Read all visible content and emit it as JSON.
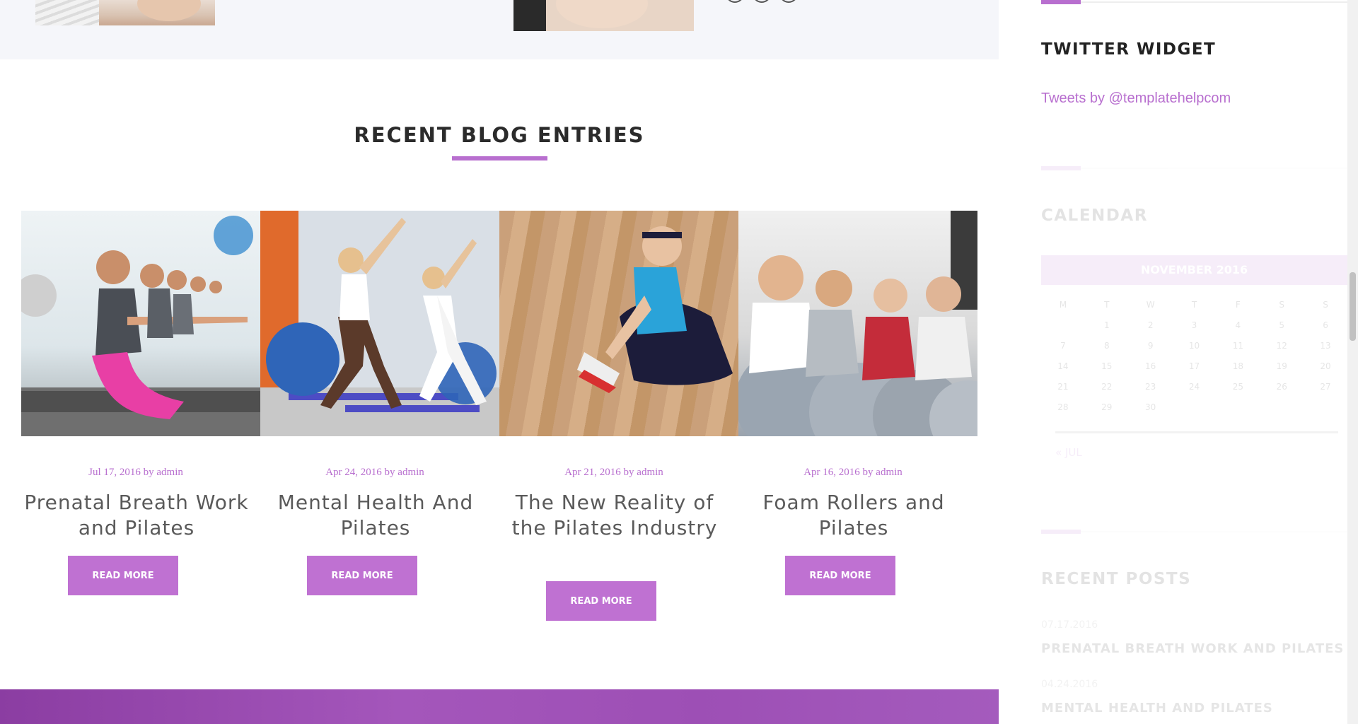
{
  "section": {
    "title": "RECENT BLOG ENTRIES"
  },
  "posts": [
    {
      "date": "Jul 17, 2016",
      "by": "by",
      "author": "admin",
      "title": "Prenatal Breath Work and Pilates",
      "button": "READ MORE"
    },
    {
      "date": "Apr 24, 2016",
      "by": "by",
      "author": "admin",
      "title": "Mental Health And Pilates",
      "button": "READ MORE"
    },
    {
      "date": "Apr 21, 2016",
      "by": "by",
      "author": "admin",
      "title": "The New Reality of the Pilates Industry",
      "button": "READ MORE"
    },
    {
      "date": "Apr 16, 2016",
      "by": "by",
      "author": "admin",
      "title": "Foam Rollers and Pilates",
      "button": "READ MORE"
    }
  ],
  "sidebar": {
    "twitter": {
      "title": "TWITTER WIDGET",
      "link": "Tweets by @templatehelpcom"
    },
    "calendar": {
      "title": "CALENDAR",
      "month": "NOVEMBER 2016",
      "weekdays": [
        "M",
        "T",
        "W",
        "T",
        "F",
        "S",
        "S"
      ],
      "weeks": [
        [
          "",
          "1",
          "2",
          "3",
          "4",
          "5",
          "6"
        ],
        [
          "7",
          "8",
          "9",
          "10",
          "11",
          "12",
          "13"
        ],
        [
          "14",
          "15",
          "16",
          "17",
          "18",
          "19",
          "20"
        ],
        [
          "21",
          "22",
          "23",
          "24",
          "25",
          "26",
          "27"
        ],
        [
          "28",
          "29",
          "30",
          "",
          "",
          "",
          ""
        ]
      ],
      "prev": "« JUL"
    },
    "recent_posts": {
      "title": "RECENT POSTS",
      "items": [
        {
          "date": "07.17.2016",
          "title": "PRENATAL BREATH WORK AND PILATES"
        },
        {
          "date": "04.24.2016",
          "title": "MENTAL HEALTH AND PILATES"
        }
      ]
    }
  },
  "colors": {
    "accent": "#b86fcf",
    "button": "#bf71d2",
    "band": "#9d4fb5"
  }
}
